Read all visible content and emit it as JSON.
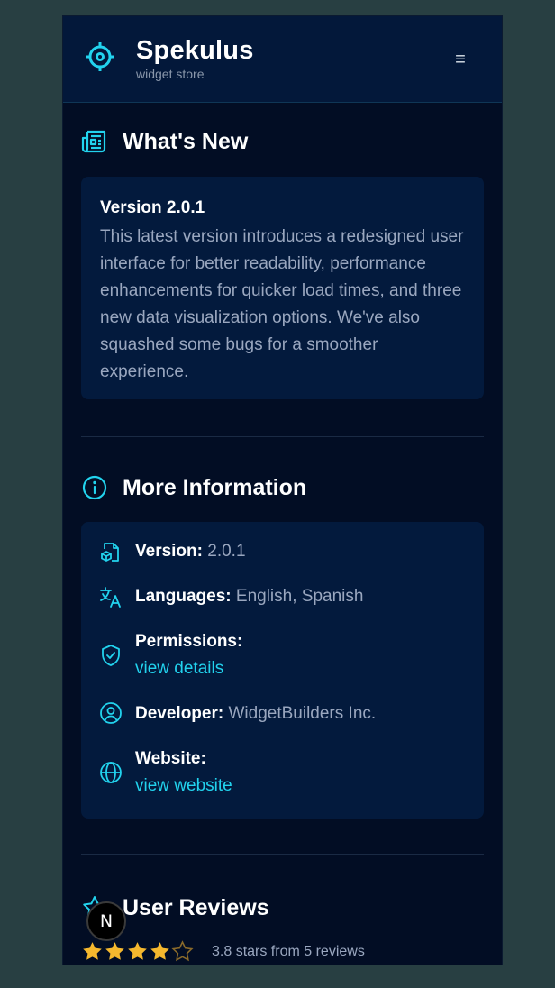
{
  "header": {
    "brand_name": "Spekulus",
    "brand_tagline": "widget store",
    "menu_icon": "≡"
  },
  "whats_new": {
    "title": "What's New",
    "version_label": "Version 2.0.1",
    "body": "This latest version introduces a redesigned user interface for better readability, performance enhancements for quicker load times, and three new data visualization options. We've also squashed some bugs for a smoother experience."
  },
  "more_info": {
    "title": "More Information",
    "version": {
      "label": "Version:",
      "value": "2.0.1"
    },
    "languages": {
      "label": "Languages:",
      "value": "English, Spanish"
    },
    "permissions": {
      "label": "Permissions:",
      "link": "view details"
    },
    "developer": {
      "label": "Developer:",
      "value": "WidgetBuilders Inc."
    },
    "website": {
      "label": "Website:",
      "link": "view website"
    }
  },
  "reviews": {
    "title": "User Reviews",
    "rating": 3.8,
    "max_rating": 5,
    "summary": "3.8 stars from 5 reviews"
  },
  "dev_badge": {
    "letter": "N"
  },
  "colors": {
    "accent": "#22d3ee",
    "background": "#020d24",
    "card": "#031a3d",
    "star": "#f5b82e"
  }
}
